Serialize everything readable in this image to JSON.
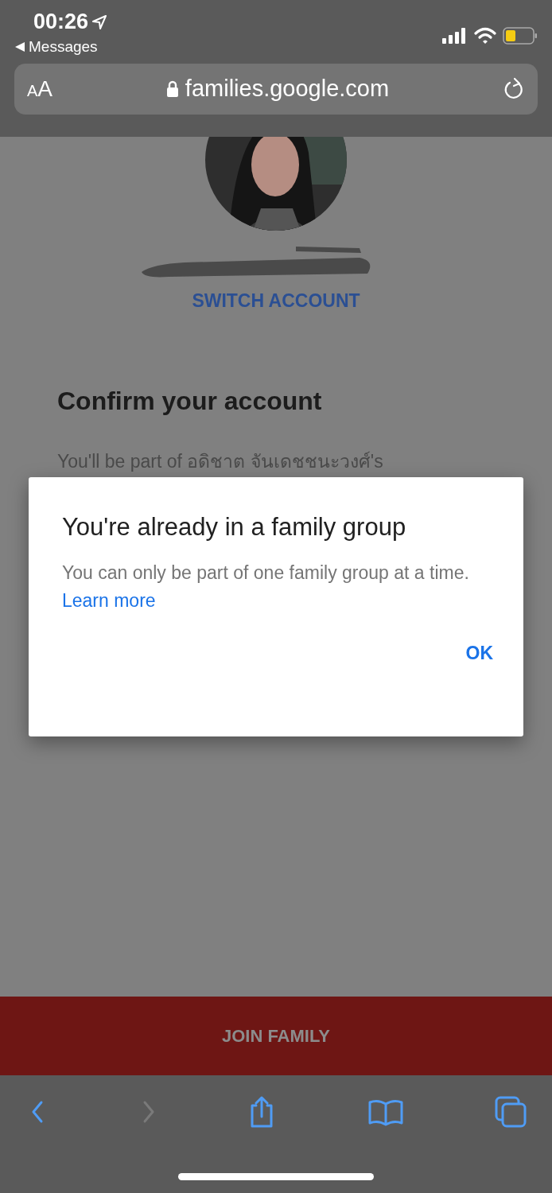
{
  "status_bar": {
    "time": "00:26",
    "back_app": "Messages"
  },
  "address_bar": {
    "text_size": "AA",
    "url": "families.google.com"
  },
  "account": {
    "switch_label": "SWITCH ACCOUNT"
  },
  "page": {
    "title": "Confirm your account",
    "intro": "You'll be part of อดิชาต จันเดชชนะวงศ์'s"
  },
  "dialog": {
    "title": "You're already in a family group",
    "body": "You can only be part of one family group at a time.",
    "link": "Learn more",
    "button": "OK"
  },
  "join_button": {
    "label": "JOIN FAMILY",
    "disabled": true
  },
  "toolbar": [
    {
      "kind": "back",
      "disabled": false
    },
    {
      "kind": "forward",
      "disabled": true
    },
    {
      "kind": "share",
      "disabled": false
    },
    {
      "kind": "bookmarks",
      "disabled": false
    },
    {
      "kind": "tabs",
      "disabled": false
    }
  ]
}
